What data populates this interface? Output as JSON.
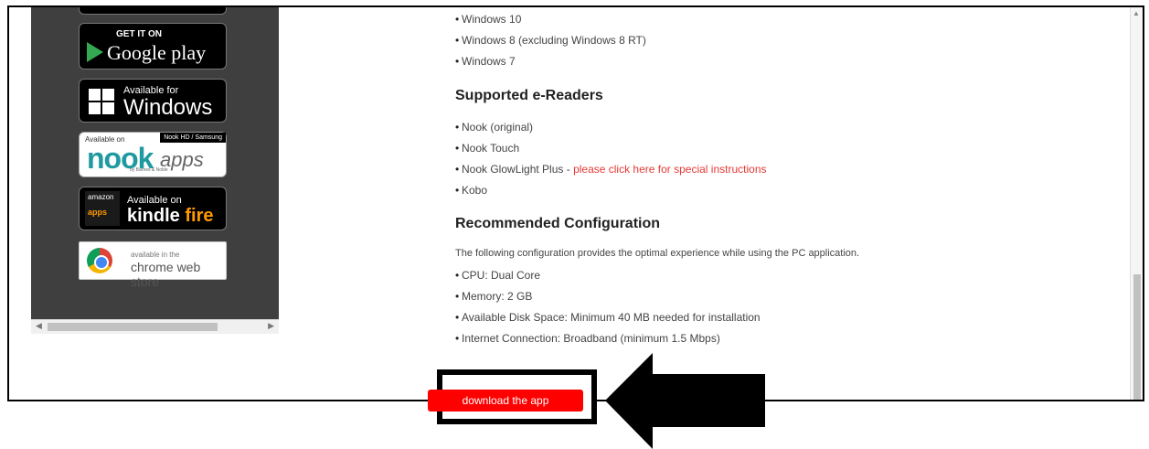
{
  "sidebar": {
    "badges": {
      "google_play_small": "GET IT ON",
      "google_play_big": "Google play",
      "windows_small": "Available for",
      "windows_big": "Windows",
      "nook_available": "Available on",
      "nook_tag": "Nook HD / Samsung",
      "nook_word": "nook",
      "nook_apps": "apps",
      "nook_bn": "by Barnes & Noble",
      "amazon_text": "amazon",
      "amazon_apps": "apps",
      "kindle_small": "Available on",
      "kindle_word": "kindle",
      "kindle_fire": "fire",
      "chrome_small": "available in the",
      "chrome_big": "chrome web store"
    },
    "icons": [
      "google-play-icon",
      "windows-logo-icon",
      "amazon-apps-icon",
      "chrome-logo-icon"
    ]
  },
  "main": {
    "os_list": [
      "Windows 10",
      "Windows 8 (excluding Windows 8 RT)",
      "Windows 7"
    ],
    "ereaders_heading": "Supported e-Readers",
    "ereaders": [
      {
        "text": "Nook (original)"
      },
      {
        "text": "Nook Touch"
      },
      {
        "text": "Nook GlowLight Plus - ",
        "link": "please click here for special instructions"
      },
      {
        "text": "Kobo"
      }
    ],
    "config_heading": "Recommended Configuration",
    "config_intro": "The following configuration provides the optimal experience while using the PC application.",
    "config_list": [
      "CPU: Dual Core",
      "Memory: 2 GB",
      "Available Disk Space: Minimum 40 MB needed for installation",
      "Internet Connection: Broadband (minimum 1.5 Mbps)"
    ],
    "download_label": "download the app"
  },
  "colors": {
    "sidebar_bg": "#3f3f3f",
    "download_button": "#ff0000",
    "link": "#e53935"
  }
}
